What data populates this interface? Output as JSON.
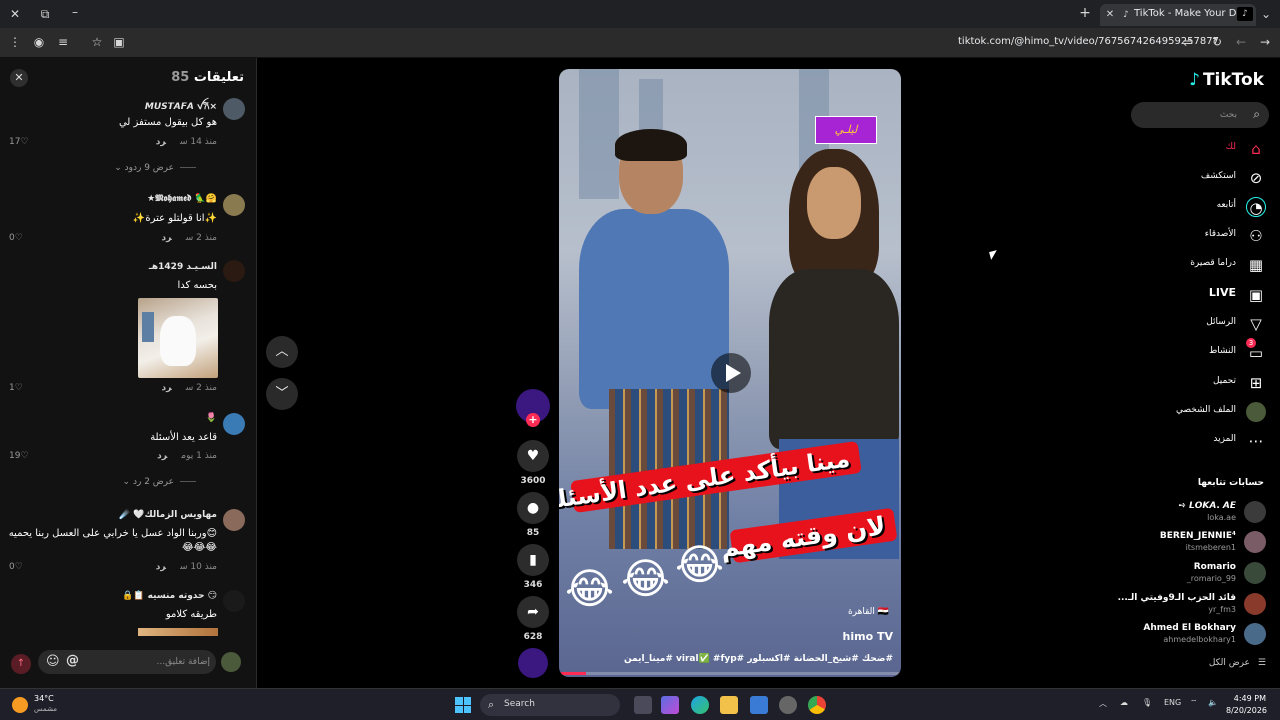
{
  "browser": {
    "tab_title": "TikTok - Make Your Day",
    "url": "tiktok.com/@himo_tv/video/7675674264959257877"
  },
  "comments": {
    "title": "تعليقات",
    "count": "85",
    "items": [
      {
        "username": "×𝙈𝙐𝙎𝙏𝘼𝙁𝘼 ꪜ𐙚",
        "text": "هو كل بيقول مستفز لي",
        "time": "منذ 14 س",
        "reply": "رد",
        "likes": "17",
        "replies": "عرض 9 ردود"
      },
      {
        "username": "🤗🦜 𝕸𝖔𝖍𝖆𝖒𝖊𝖉★",
        "text": "✨انا قولتلو عترة✨",
        "time": "منذ 2 س",
        "reply": "رد",
        "likes": "0"
      },
      {
        "username": "السـيـد 1429هـ",
        "text": "بحسه كدا",
        "time": "منذ 2 س",
        "reply": "رد",
        "likes": "1"
      },
      {
        "username": "🌷",
        "text": "قاعد يعد الأسئلة",
        "time": "منذ 1 يوم",
        "reply": "رد",
        "likes": "19",
        "replies": "عرض 2 رد"
      },
      {
        "username": "مهاويس الزمالك🤍 ☄️",
        "text": "😊وربنا الواد عسل يا خرابي على العسل ربنا يحميه",
        "text2": "😂😂😂",
        "time": "منذ 10 س",
        "reply": "رد",
        "likes": "0"
      },
      {
        "username": "😏 حدوته منسيه 📋🔒",
        "text": "طريقه كلامو"
      }
    ],
    "input_placeholder": "إضافة تعليق...",
    "emoji_glyph": "☺",
    "at_glyph": "@"
  },
  "video": {
    "watermark": "ليلـي",
    "caption_line1": "مينا بيأكد على عدد الأسئلة",
    "caption_line2": "لان وقته مهم",
    "laugh_emoji": "😂",
    "location": "🇪🇬 القاهرة",
    "author": "himo TV",
    "hashtags": "#ضحك #شيخ_الحضانة #اكسبلور #viral✅ #fyp #مينا_ايمن",
    "progress": 0.08
  },
  "actions": {
    "likes": "3600",
    "comments": "85",
    "saves": "346",
    "shares": "628"
  },
  "sidebar": {
    "logo": "TikTok",
    "search_placeholder": "بحث",
    "nav": [
      {
        "label": "لك",
        "icon": "home-icon",
        "active": true
      },
      {
        "label": "استكشف",
        "icon": "compass-icon"
      },
      {
        "label": "أتابعه",
        "icon": "following-icon"
      },
      {
        "label": "الأصدقاء",
        "icon": "friends-icon"
      },
      {
        "label": "دراما قصيرة",
        "icon": "drama-icon"
      },
      {
        "label": "LIVE",
        "icon": "live-icon"
      },
      {
        "label": "الرسائل",
        "icon": "messages-icon"
      },
      {
        "label": "النشاط",
        "icon": "activity-icon",
        "badge": "3"
      },
      {
        "label": "تحميل",
        "icon": "upload-icon"
      },
      {
        "label": "الملف الشخصي",
        "icon": "profile-icon"
      },
      {
        "label": "المزيد",
        "icon": "more-icon"
      }
    ],
    "following_title": "حسابات تتابعها",
    "accounts": [
      {
        "name": "𝙇𝙊𝙆𝘼. 𝘼𝙀 ➺",
        "handle": "loka.ae",
        "color": "#3b3b3b"
      },
      {
        "name": "BEREN_JENNIE⁴",
        "handle": "itsmeberen1",
        "color": "#7a5c66"
      },
      {
        "name": "Romario",
        "handle": "romario_99_",
        "color": "#3a4a3a"
      },
      {
        "name": "قائد الحزب الـ9وفيتي الـ...",
        "handle": "yr_fm3",
        "color": "#8a3a2a"
      },
      {
        "name": "Ahmed El Bokhary",
        "handle": "ahmedelbokhary1",
        "color": "#4a6a8a"
      }
    ],
    "see_all": "عرض الكل"
  },
  "taskbar": {
    "temp": "34°C",
    "weather": "مشمس",
    "search": "Search",
    "lang": "ENG",
    "time": "4:49 PM",
    "date": "8/20/2026"
  }
}
